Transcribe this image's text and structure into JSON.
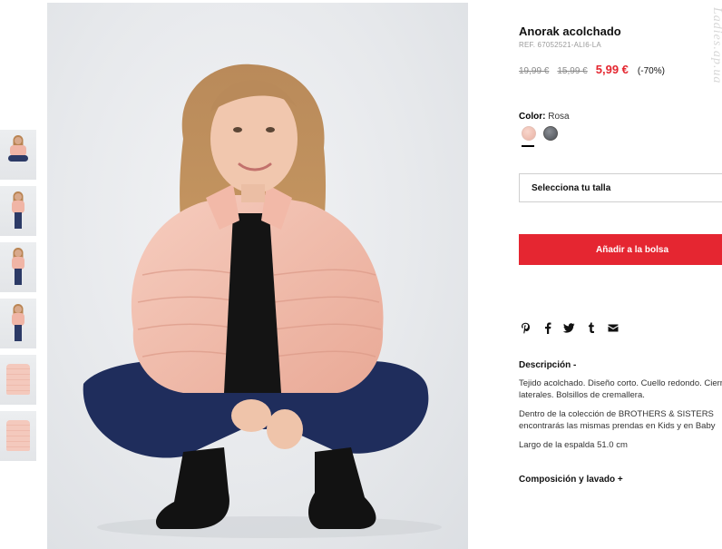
{
  "product": {
    "title": "Anorak acolchado",
    "ref": "REF. 67052521-ALI6-LA",
    "price_original_1": "19,99 €",
    "price_original_2": "15,99 €",
    "price_current": "5,99 €",
    "discount": "(-70%)",
    "price_color": "#e4262f"
  },
  "color": {
    "label": "Color:",
    "value": "Rosa",
    "swatches": [
      {
        "name": "Rosa",
        "hex": "#f2c3b7"
      },
      {
        "name": "Gris",
        "hex": "#5f6369"
      }
    ]
  },
  "size_select": {
    "placeholder": "Selecciona tu talla"
  },
  "add_to_bag": {
    "label": "Añadir a la bolsa",
    "color": "#e52631"
  },
  "share_icons": [
    "pinterest-icon",
    "facebook-icon",
    "twitter-icon",
    "tumblr-icon",
    "mail-icon"
  ],
  "description": {
    "title": "Descripción -",
    "lines": [
      "Tejido acolchado. Diseño corto. Cuello redondo. Cierre con cremallera. Bolsillos",
      "laterales. Bolsillos de cremallera."
    ],
    "collection_lines": [
      "Dentro de la colección de BROTHERS & SISTERS",
      "encontrarás las mismas prendas en Kids y en Baby"
    ],
    "length": "Largo de la espalda 51.0 cm"
  },
  "composition": {
    "title": "Composición y lavado +"
  },
  "watermark": "Ladies.ap.ua",
  "thumbnails": [
    "crouch",
    "standing",
    "standing",
    "standing",
    "garment",
    "garment"
  ]
}
